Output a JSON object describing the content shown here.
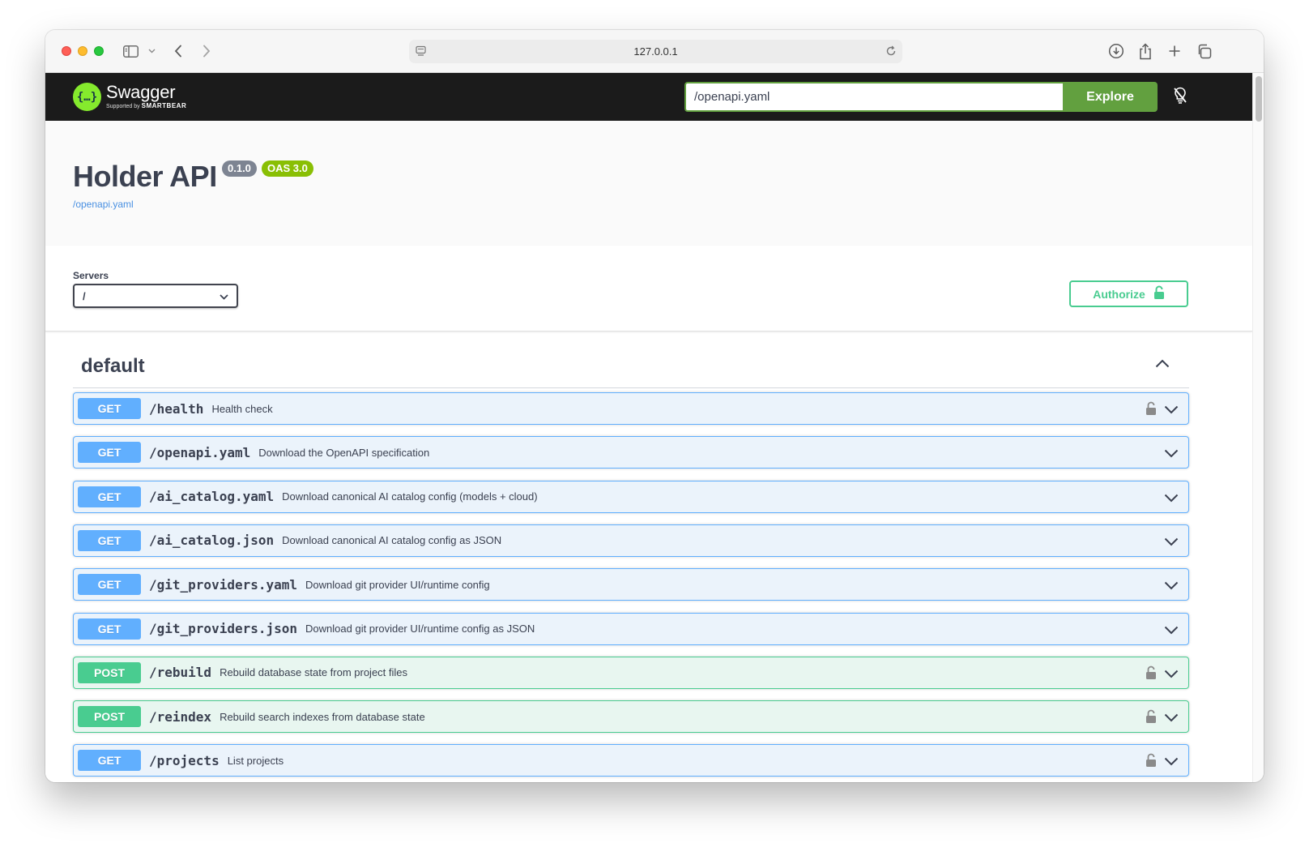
{
  "browser": {
    "url": "127.0.0.1"
  },
  "topbar": {
    "logo_title": "Swagger",
    "logo_supported": "Supported by",
    "logo_brand": "SMARTBEAR",
    "spec_url": "/openapi.yaml",
    "explore_label": "Explore"
  },
  "info": {
    "title": "Holder API",
    "version": "0.1.0",
    "oas_version": "OAS 3.0",
    "spec_link": "/openapi.yaml"
  },
  "servers": {
    "label": "Servers",
    "selected": "/",
    "authorize_label": "Authorize"
  },
  "tag": {
    "name": "default"
  },
  "operations": [
    {
      "method": "GET",
      "path": "/health",
      "summary": "Health check",
      "locked": true
    },
    {
      "method": "GET",
      "path": "/openapi.yaml",
      "summary": "Download the OpenAPI specification",
      "locked": false
    },
    {
      "method": "GET",
      "path": "/ai_catalog.yaml",
      "summary": "Download canonical AI catalog config (models + cloud)",
      "locked": false
    },
    {
      "method": "GET",
      "path": "/ai_catalog.json",
      "summary": "Download canonical AI catalog config as JSON",
      "locked": false
    },
    {
      "method": "GET",
      "path": "/git_providers.yaml",
      "summary": "Download git provider UI/runtime config",
      "locked": false
    },
    {
      "method": "GET",
      "path": "/git_providers.json",
      "summary": "Download git provider UI/runtime config as JSON",
      "locked": false
    },
    {
      "method": "POST",
      "path": "/rebuild",
      "summary": "Rebuild database state from project files",
      "locked": true
    },
    {
      "method": "POST",
      "path": "/reindex",
      "summary": "Rebuild search indexes from database state",
      "locked": true
    },
    {
      "method": "GET",
      "path": "/projects",
      "summary": "List projects",
      "locked": true
    }
  ],
  "colors": {
    "get": "#61affe",
    "post": "#49cc90",
    "explore": "#62a03f",
    "topbar": "#1b1b1b"
  }
}
